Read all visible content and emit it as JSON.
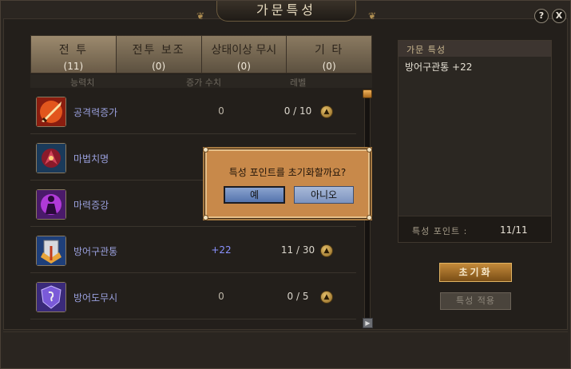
{
  "window": {
    "title": "가문특성",
    "help_label": "?",
    "close_label": "X"
  },
  "tabs": [
    {
      "name": "전 투",
      "count": "(11)"
    },
    {
      "name": "전투 보조",
      "count": "(0)"
    },
    {
      "name": "상태이상 무시",
      "count": "(0)"
    },
    {
      "name": "기 타",
      "count": "(0)"
    }
  ],
  "columns": {
    "ability": "능력치",
    "increase": "증가 수치",
    "level": "레벨"
  },
  "skills": [
    {
      "name": "공격력증가",
      "increase": "0",
      "level": "0 / 10",
      "icon": "sword-fire-icon"
    },
    {
      "name": "마법치명",
      "increase": "",
      "level": "",
      "icon": "magic-critical-icon"
    },
    {
      "name": "마력증강",
      "increase": "",
      "level": "",
      "icon": "mana-boost-icon"
    },
    {
      "name": "방어구관통",
      "increase": "+22",
      "level": "11 / 30",
      "icon": "armor-pierce-icon"
    },
    {
      "name": "방어도무시",
      "increase": "0",
      "level": "0 / 5",
      "icon": "shield-ignore-icon"
    }
  ],
  "side_panel": {
    "title": "가문 특성",
    "effect": "방어구관통 +22",
    "points_label": "특성 포인트 :",
    "points_value": "11/11"
  },
  "buttons": {
    "reset": "초기화",
    "apply": "특성 적용"
  },
  "dialog": {
    "message": "특성 포인트를 초기화할까요?",
    "yes": "예",
    "no": "아니오"
  },
  "colors": {
    "skill_name": "#9aa0de",
    "positive_value": "#8a92ff",
    "dialog_bg": "#c8894a",
    "accent_gold": "#c48a3a"
  }
}
